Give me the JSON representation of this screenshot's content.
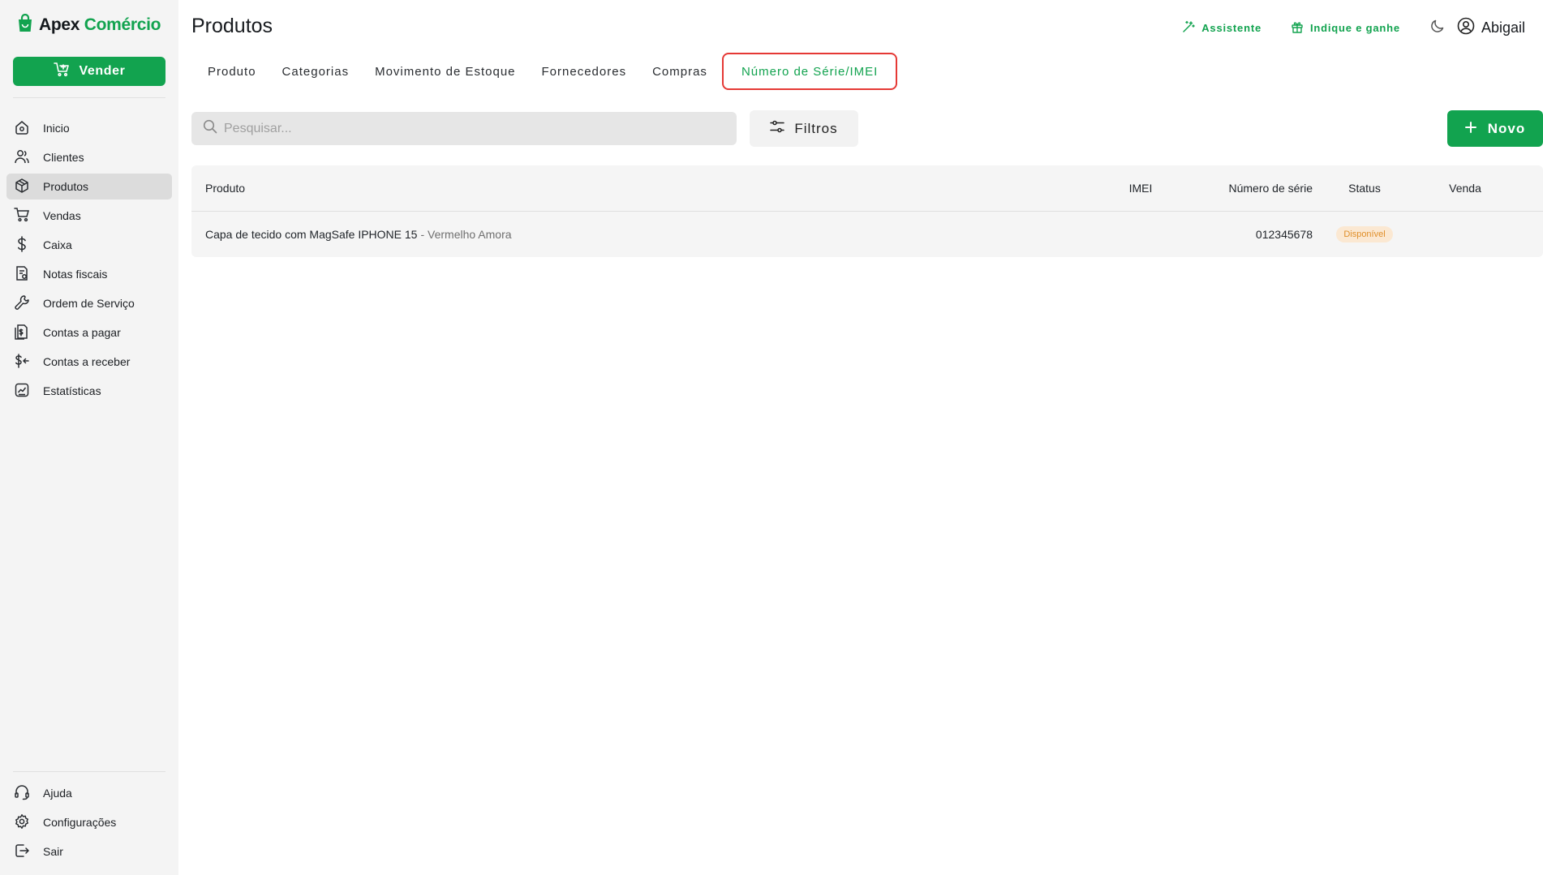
{
  "brand": {
    "name_part1": "Apex",
    "name_part2": "Comércio"
  },
  "sell_button": "Vender",
  "nav": [
    {
      "label": "Inicio",
      "icon": "home-icon"
    },
    {
      "label": "Clientes",
      "icon": "users-icon"
    },
    {
      "label": "Produtos",
      "icon": "box-icon",
      "active": true
    },
    {
      "label": "Vendas",
      "icon": "cart-icon"
    },
    {
      "label": "Caixa",
      "icon": "dollar-icon"
    },
    {
      "label": "Notas fiscais",
      "icon": "invoice-icon"
    },
    {
      "label": "Ordem de Serviço",
      "icon": "wrench-icon"
    },
    {
      "label": "Contas a pagar",
      "icon": "bills-icon"
    },
    {
      "label": "Contas a receber",
      "icon": "receive-icon"
    },
    {
      "label": "Estatísticas",
      "icon": "chart-icon"
    }
  ],
  "nav_bottom": [
    {
      "label": "Ajuda",
      "icon": "headset-icon"
    },
    {
      "label": "Configurações",
      "icon": "gear-icon"
    },
    {
      "label": "Sair",
      "icon": "logout-icon"
    }
  ],
  "header": {
    "title": "Produtos",
    "assistant": "Assistente",
    "refer": "Indique e ganhe",
    "user": "Abigail"
  },
  "tabs": [
    "Produto",
    "Categorias",
    "Movimento de Estoque",
    "Fornecedores",
    "Compras",
    "Número de Série/IMEI"
  ],
  "active_tab": "Número de Série/IMEI",
  "search": {
    "placeholder": "Pesquisar..."
  },
  "filters_button": "Filtros",
  "new_button": "Novo",
  "table": {
    "columns": {
      "product": "Produto",
      "imei": "IMEI",
      "serial": "Número de série",
      "status": "Status",
      "sale": "Venda"
    },
    "rows": [
      {
        "product": "Capa de tecido com MagSafe IPHONE 15",
        "variant": "- Vermelho Amora",
        "imei": "",
        "serial": "012345678",
        "status": "Disponível",
        "sale": ""
      }
    ]
  },
  "colors": {
    "brand_green": "#12a34f",
    "highlight_red": "#e53935",
    "badge_bg": "#fbe8d2",
    "badge_text": "#e08f2a"
  }
}
